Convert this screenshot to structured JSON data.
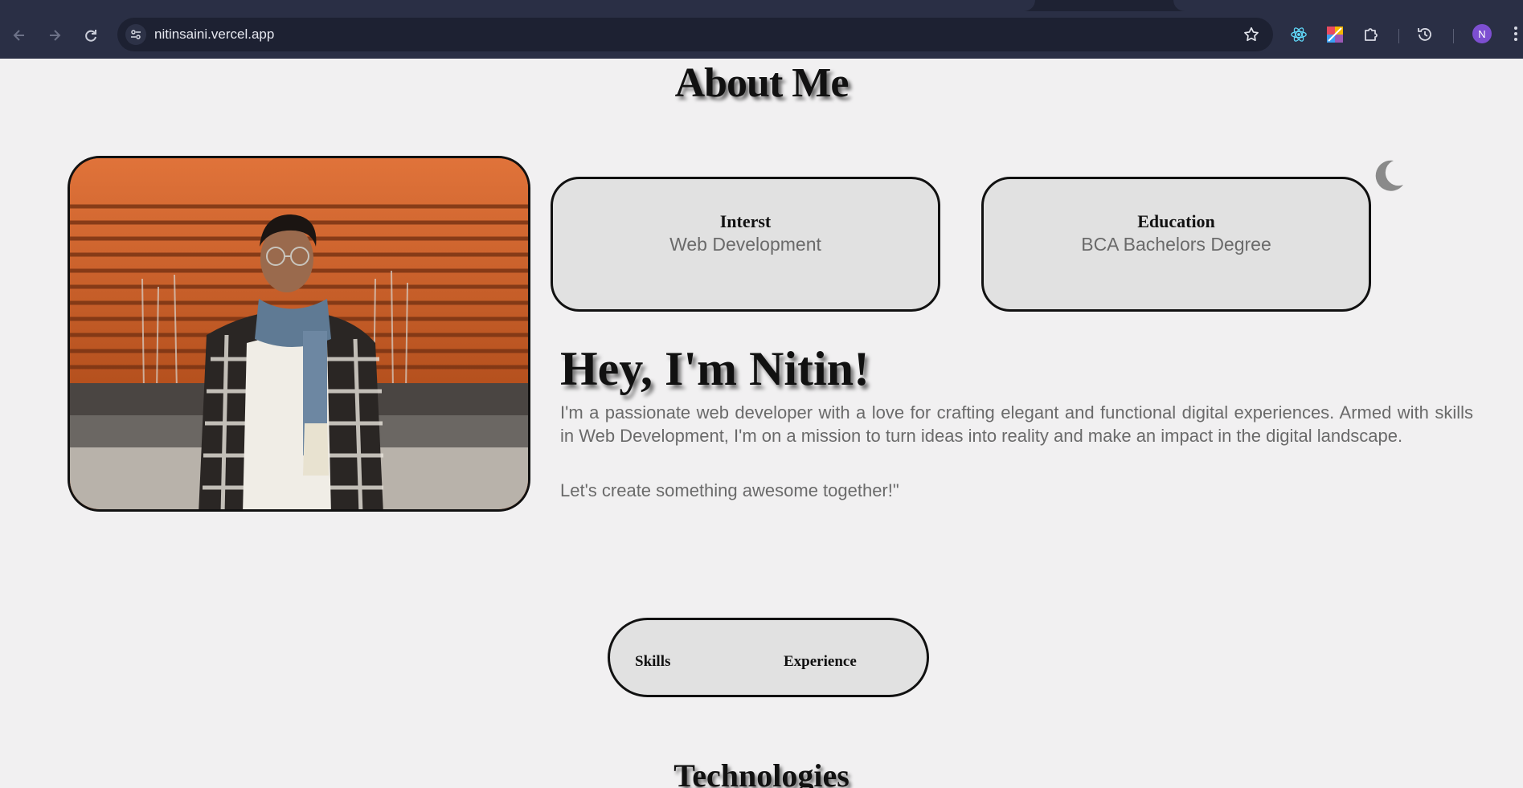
{
  "browser": {
    "url": "nitinsaini.vercel.app",
    "profile_initial": "N"
  },
  "page": {
    "about_heading": "About Me",
    "cards": [
      {
        "title": "Interst",
        "value": "Web Development"
      },
      {
        "title": "Education",
        "value": "BCA Bachelors Degree"
      }
    ],
    "hero_title": "Hey, I'm Nitin!",
    "bio": "I'm a passionate web developer with a love for crafting elegant and functional digital experiences. Armed with skills in Web Development, I'm on a mission to turn ideas into reality and make an impact in the digital landscape.",
    "cta": "Let's create something awesome together!\"",
    "tabs": {
      "skills": "Skills",
      "experience": "Experience"
    },
    "tech_heading": "Technologies"
  },
  "icons": {
    "theme_toggle": "moon-icon",
    "profile_photo": "profile-photo"
  },
  "colors": {
    "page_bg": "#f1f0f1",
    "card_bg": "#e1e1e1",
    "body_text": "#6a6a6a",
    "chrome_bg": "#2a2f45"
  }
}
